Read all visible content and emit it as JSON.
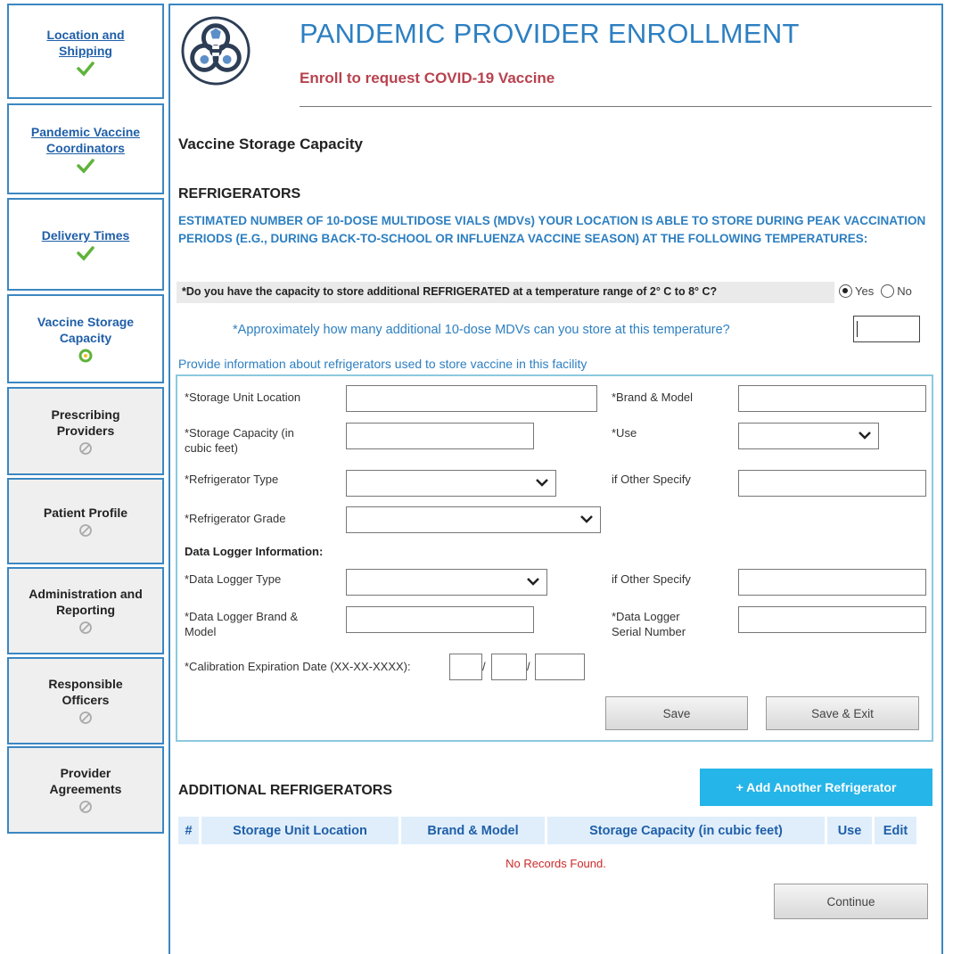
{
  "sidebar": {
    "items": [
      {
        "label_line1": "Location and",
        "label_line2": "Shipping",
        "status_icon": "check-icon",
        "link": true
      },
      {
        "label_line1": "Pandemic Vaccine",
        "label_line2": "Coordinators",
        "status_icon": "check-icon",
        "link": true
      },
      {
        "label_line1": "Delivery Times",
        "label_line2": "",
        "status_icon": "check-icon",
        "link": true
      },
      {
        "label_line1": "Vaccine Storage",
        "label_line2": "Capacity",
        "status_icon": "in-progress-icon",
        "current": true
      },
      {
        "label_line1": "Prescribing",
        "label_line2": "Providers",
        "status_icon": "disabled-icon"
      },
      {
        "label_line1": "Patient Profile",
        "label_line2": "",
        "status_icon": "disabled-icon"
      },
      {
        "label_line1": "Administration and",
        "label_line2": "Reporting",
        "status_icon": "disabled-icon"
      },
      {
        "label_line1": "Responsible",
        "label_line2": "Officers",
        "status_icon": "disabled-icon"
      },
      {
        "label_line1": "Provider",
        "label_line2": "Agreements",
        "status_icon": "disabled-icon"
      }
    ]
  },
  "header": {
    "title": "PANDEMIC PROVIDER ENROLLMENT",
    "subtitle": "Enroll to request COVID-19 Vaccine"
  },
  "section_title": "Vaccine Storage Capacity",
  "refrigerators": {
    "title": "REFRIGERATORS",
    "estimate_text": "ESTIMATED NUMBER OF 10-DOSE MULTIDOSE VIALS (MDVs) YOUR LOCATION IS ABLE TO STORE DURING PEAK VACCINATION PERIODS (E.G., DURING BACK-TO-SCHOOL OR INFLUENZA VACCINE SEASON) AT THE FOLLOWING TEMPERATURES:",
    "capacity_question": "*Do you have the capacity to store additional REFRIGERATED at a temperature range of 2° C to 8° C?",
    "yes_label": "Yes",
    "no_label": "No",
    "selected": "Yes",
    "approx_question": "*Approximately how many additional 10-dose MDVs can you store at this temperature?",
    "approx_value": "",
    "provide_info": "Provide information about refrigerators used to store vaccine in this facility"
  },
  "form": {
    "storage_unit_location_label": "*Storage Unit Location",
    "brand_model_label": "*Brand & Model",
    "storage_capacity_label_1": "*Storage Capacity (in",
    "storage_capacity_label_2": "cubic feet)",
    "use_label": "*Use",
    "refrigerator_type_label": "*Refrigerator Type",
    "if_other_label": "if Other Specify",
    "refrigerator_grade_label": "*Refrigerator Grade",
    "data_logger_heading": "Data Logger Information:",
    "data_logger_type_label": "*Data Logger Type",
    "if_other_label_2": "if Other Specify",
    "data_logger_brand_label_1": "*Data Logger Brand &",
    "data_logger_brand_label_2": "Model",
    "data_logger_serial_label_1": "*Data Logger",
    "data_logger_serial_label_2": "Serial Number",
    "calibration_label": "*Calibration Expiration Date (XX-XX-XXXX):",
    "date_sep": "/",
    "save_label": "Save",
    "save_exit_label": "Save & Exit"
  },
  "additional": {
    "title": "ADDITIONAL REFRIGERATORS",
    "add_button": "+ Add Another Refrigerator",
    "columns": [
      "#",
      "Storage Unit Location",
      "Brand & Model",
      "Storage Capacity (in cubic feet)",
      "Use",
      "Edit"
    ],
    "empty_message": "No Records Found.",
    "continue_label": "Continue"
  },
  "colors": {
    "accent_blue": "#2d7fc1",
    "subtitle_red": "#b8424f",
    "add_button_bg": "#25b5e8",
    "check_green": "#5fb33a",
    "error_red": "#cc2a2a"
  }
}
